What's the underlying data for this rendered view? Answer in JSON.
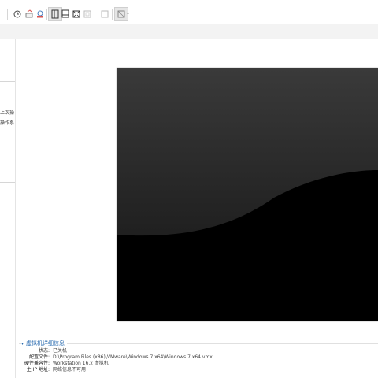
{
  "toolbar": {
    "icons": [
      "clock-icon",
      "snapshot-revert-icon",
      "snapshot-manager-icon",
      "sidebar-toggle-icon",
      "console-view-icon",
      "fullscreen-icon",
      "unity-icon",
      "thumbnail-icon",
      "view-dropdown-icon"
    ]
  },
  "sidebar": {
    "items": [
      {
        "label": "上次操作到..."
      },
      {
        "label": "操作系统..."
      }
    ]
  },
  "details": {
    "title": "虚拟机详细信息",
    "rows": [
      {
        "key": "状态:",
        "value": "已关机"
      },
      {
        "key": "配置文件:",
        "value": "D:\\Program Files (x86)\\VMware\\Windows 7 x64\\Windows 7 x64.vmx"
      },
      {
        "key": "硬件兼容性:",
        "value": "Workstation 16.x 虚拟机"
      },
      {
        "key": "主 IP 地址:",
        "value": "网络信息不可用"
      }
    ]
  },
  "colors": {
    "accent": "#2b6cb0",
    "screen_dark": "#000000",
    "screen_light": "#3a3a3a"
  }
}
